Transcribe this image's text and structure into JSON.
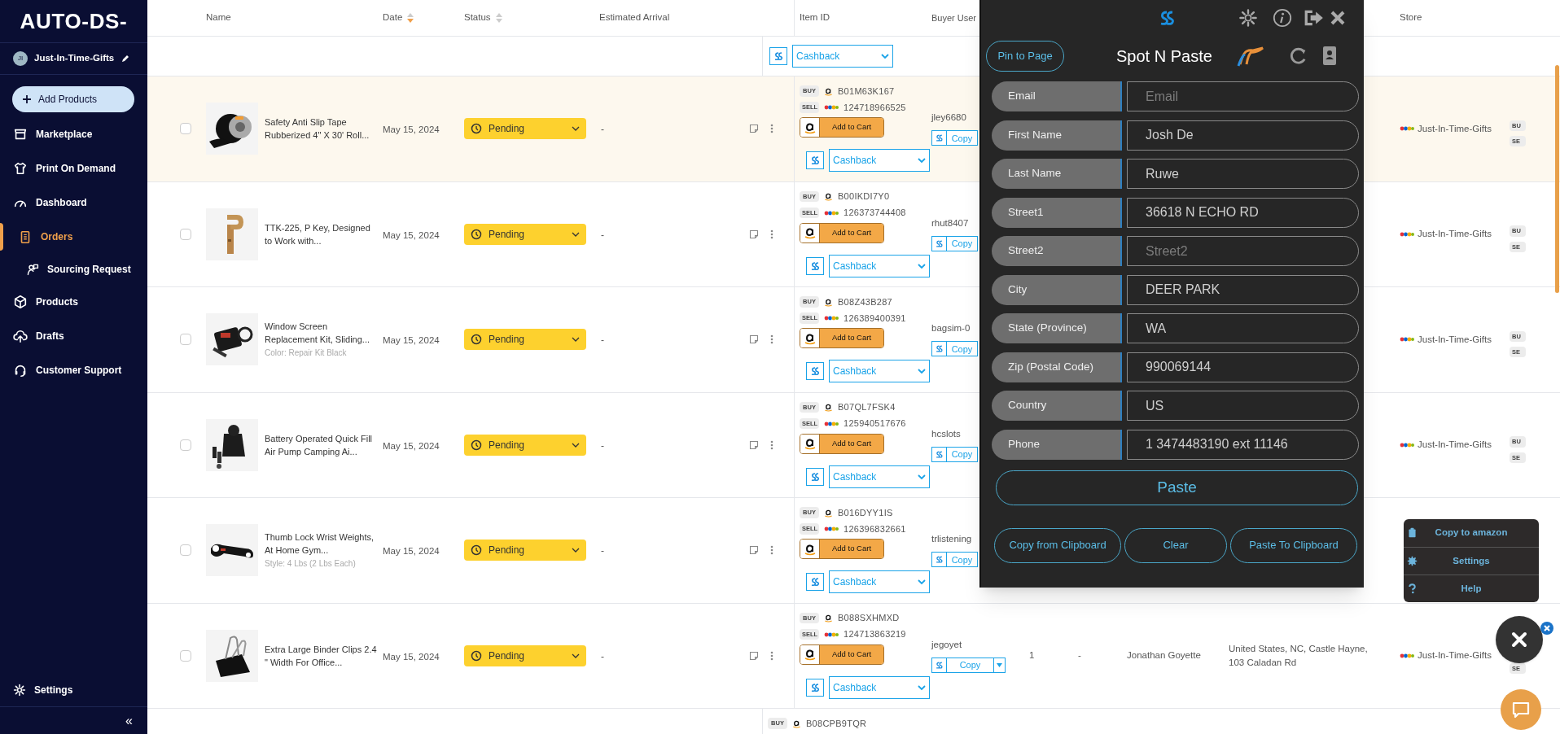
{
  "sidebar": {
    "logo": "AUTO-DS-",
    "store": {
      "initials": "JI",
      "name": "Just-In-Time-Gifts"
    },
    "add_button": "Add Products",
    "nav": [
      {
        "label": "Marketplace",
        "selected": false
      },
      {
        "label": "Print On Demand",
        "selected": false
      },
      {
        "label": "Dashboard",
        "selected": false
      },
      {
        "label": "Orders",
        "selected": true,
        "children": [
          {
            "label": "Sourcing Request",
            "selected": false
          }
        ]
      },
      {
        "label": "Products",
        "selected": false
      },
      {
        "label": "Drafts",
        "selected": false
      },
      {
        "label": "Customer Support",
        "selected": false
      }
    ],
    "settings": "Settings",
    "collapse": "«"
  },
  "table": {
    "columns": [
      {
        "label": "Name"
      },
      {
        "label": "Date",
        "sorted": true
      },
      {
        "label": "Status",
        "sorted": false
      },
      {
        "label": "Estimated Arrival"
      },
      {
        "label": "Item ID"
      },
      {
        "label": "Buyer User"
      },
      {
        "label": "Store"
      }
    ],
    "rows": [
      {
        "kind": "tail",
        "cashback": "Cashback"
      },
      {
        "kind": "order",
        "highlighted": true,
        "checked": false,
        "name": "Safety Anti Slip Tape Rubberized 4\" X 30' Roll...",
        "date": "May 15, 2024",
        "status": "Pending",
        "arrival": "-",
        "buy_label": "BUY",
        "buy_id": "B01M63K167",
        "sell_label": "SELL",
        "sell_id": "124718966525",
        "cart": "Add to Cart",
        "cashback": "Cashback",
        "buyer": "jley6680",
        "copy": "Copy",
        "store": "Just-In-Time-Gifts",
        "badges": [
          "BU",
          "SE"
        ]
      },
      {
        "kind": "order",
        "highlighted": false,
        "checked": false,
        "name": "TTK-225, P Key, Designed to Work with...",
        "date": "May 15, 2024",
        "status": "Pending",
        "arrival": "-",
        "buy_label": "BUY",
        "buy_id": "B00IKDI7Y0",
        "sell_label": "SELL",
        "sell_id": "126373744408",
        "cart": "Add to Cart",
        "cashback": "Cashback",
        "buyer": "rhut8407",
        "copy": "Copy",
        "store": "Just-In-Time-Gifts",
        "badges": [
          "BU",
          "SE"
        ]
      },
      {
        "kind": "order",
        "highlighted": false,
        "checked": false,
        "name": "Window Screen Replacement Kit, Sliding...",
        "variant": "Color: Repair Kit Black",
        "date": "May 15, 2024",
        "status": "Pending",
        "arrival": "-",
        "buy_label": "BUY",
        "buy_id": "B08Z43B287",
        "sell_label": "SELL",
        "sell_id": "126389400391",
        "cart": "Add to Cart",
        "cashback": "Cashback",
        "buyer": "bagsim-0",
        "copy": "Copy",
        "store": "Just-In-Time-Gifts",
        "badges": [
          "BU",
          "SE"
        ]
      },
      {
        "kind": "order",
        "highlighted": false,
        "checked": false,
        "name": "Battery Operated Quick Fill Air Pump Camping Ai...",
        "date": "May 15, 2024",
        "status": "Pending",
        "arrival": "-",
        "buy_label": "BUY",
        "buy_id": "B07QL7FSK4",
        "sell_label": "SELL",
        "sell_id": "125940517676",
        "cart": "Add to Cart",
        "cashback": "Cashback",
        "buyer": "hcslots",
        "copy": "Copy",
        "store": "Just-In-Time-Gifts",
        "badges": [
          "BU",
          "SE"
        ]
      },
      {
        "kind": "order",
        "highlighted": false,
        "checked": false,
        "name": "Thumb Lock Wrist Weights, At Home Gym...",
        "variant": "Style: 4 Lbs (2 Lbs Each)",
        "date": "May 15, 2024",
        "status": "Pending",
        "arrival": "-",
        "buy_label": "BUY",
        "buy_id": "B016DYY1IS",
        "sell_label": "SELL",
        "sell_id": "126396832661",
        "cart": "Add to Cart",
        "cashback": "Cashback",
        "buyer": "trlistening",
        "copy": "Copy"
      },
      {
        "kind": "order",
        "highlighted": false,
        "checked": false,
        "name": "Extra Large Binder Clips 2.4 \" Width For Office...",
        "date": "May 15, 2024",
        "status": "Pending",
        "arrival": "-",
        "buy_label": "BUY",
        "buy_id": "B088SXHMXD",
        "sell_label": "SELL",
        "sell_id": "124713863219",
        "cart": "Add to Cart",
        "cashback": "Cashback",
        "buyer": "jegoyet",
        "copy": "Copy",
        "copy_menu": true,
        "column_9": "1",
        "column_10": "-",
        "column_11": "Jonathan Goyette",
        "column_12": "United States, NC, Castle Hayne, 103 Caladan Rd",
        "store": "Just-In-Time-Gifts",
        "badges": [
          "SE"
        ]
      },
      {
        "kind": "head",
        "buy_label": "BUY",
        "buy_id": "B08CPB9TQR"
      }
    ]
  },
  "popup": {
    "pin": "Pin to Page",
    "title": "Spot N Paste",
    "fields": [
      {
        "label": "Email",
        "placeholder": "Email"
      },
      {
        "label": "First Name",
        "value": "Josh De"
      },
      {
        "label": "Last Name",
        "value": "Ruwe"
      },
      {
        "label": "Street1",
        "value": "36618 N ECHO RD"
      },
      {
        "label": "Street2",
        "placeholder": "Street2"
      },
      {
        "label": "City",
        "value": "DEER PARK"
      },
      {
        "label": "State (Province)",
        "value": "WA"
      },
      {
        "label": "Zip (Postal Code)",
        "value": "990069144"
      },
      {
        "label": "Country",
        "value": "US"
      },
      {
        "label": "Phone",
        "value": "1 3474483190 ext 11146"
      }
    ],
    "paste": "Paste",
    "buttons": [
      "Copy from Clipboard",
      "Clear",
      "Paste To Clipboard"
    ]
  },
  "menu": {
    "items": [
      "Copy to amazon",
      "Settings",
      "Help"
    ]
  }
}
